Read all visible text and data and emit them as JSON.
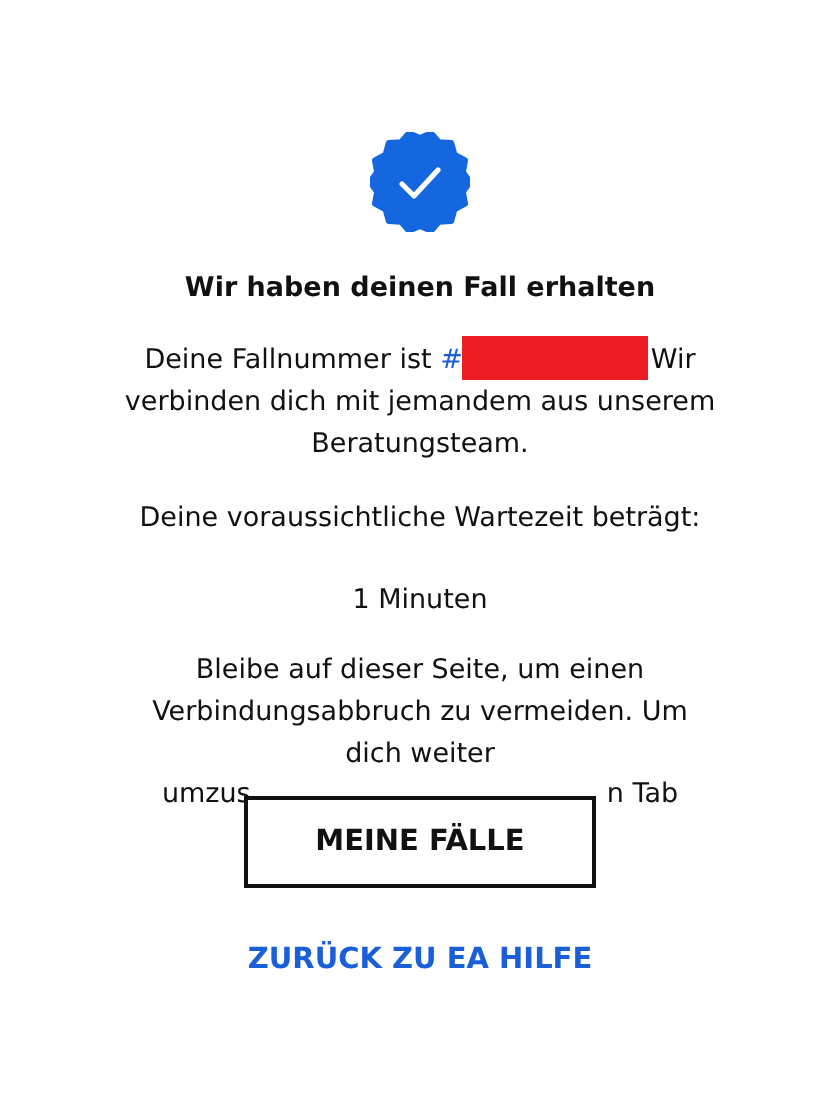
{
  "title": "Wir haben deinen Fall erhalten",
  "case_text": {
    "lead": "Deine Fallnummer ist",
    "hash": "#",
    "rest": "Wir verbinden dich mit jemandem aus unserem Beratungsteam."
  },
  "wait_label": "Deine voraussichtliche Wartezeit beträgt:",
  "wait_time": "1 Minuten",
  "notice": "Bleibe auf dieser Seite, um einen Verbindungsabbruch zu vermeiden. Um dich weiter",
  "notice_cut": [
    "umzus",
    "n Tab"
  ],
  "button": "MEINE FÄLLE",
  "link": "ZURÜCK ZU EA HILFE"
}
